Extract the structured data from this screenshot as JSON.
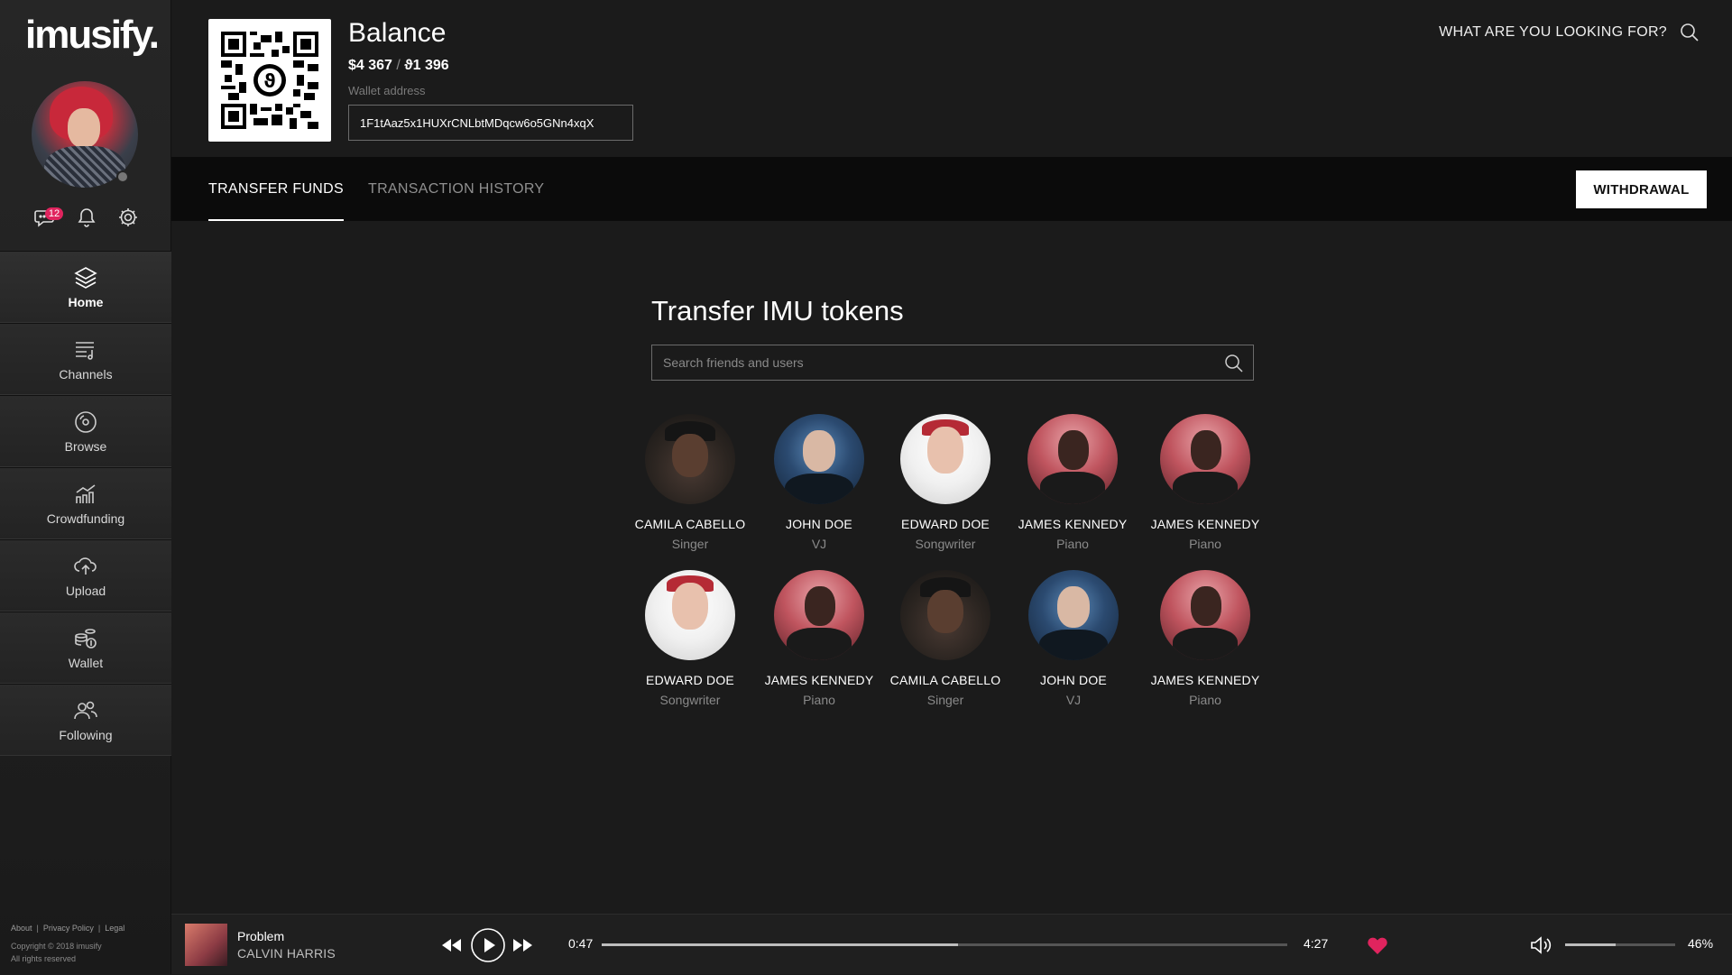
{
  "app": {
    "logo": "imusify."
  },
  "sidebar": {
    "messages_badge": "12",
    "nav": [
      {
        "label": "Home",
        "icon": "layers-icon",
        "active": true
      },
      {
        "label": "Channels",
        "icon": "playlist-icon"
      },
      {
        "label": "Browse",
        "icon": "disc-icon"
      },
      {
        "label": "Crowdfunding",
        "icon": "chart-icon"
      },
      {
        "label": "Upload",
        "icon": "cloud-upload-icon"
      },
      {
        "label": "Wallet",
        "icon": "coins-icon"
      },
      {
        "label": "Following",
        "icon": "users-icon"
      }
    ],
    "footer": {
      "links": [
        "About",
        "Privacy Policy",
        "Legal"
      ],
      "copyright": "Copyright © 2018 imusify",
      "rights": "All rights reserved"
    }
  },
  "header": {
    "balance_title": "Balance",
    "usd": "$4 367",
    "sep": "/",
    "tokens": "ϑ1 396",
    "wallet_label": "Wallet address",
    "wallet_address": "1F1tAaz5x1HUXrCNLbtMDqcw6o5GNn4xqX",
    "search_label": "WHAT ARE YOU LOOKING FOR?"
  },
  "tabs": [
    {
      "label": "TRANSFER FUNDS",
      "active": true
    },
    {
      "label": "TRANSACTION HISTORY",
      "active": false
    }
  ],
  "withdraw_label": "WITHDRAWAL",
  "main": {
    "title": "Transfer IMU tokens",
    "search_placeholder": "Search friends and users",
    "users": [
      {
        "name": "CAMILA CABELLO",
        "role": "Singer",
        "avatar": "p-cc"
      },
      {
        "name": "JOHN DOE",
        "role": "VJ",
        "avatar": "p-jd"
      },
      {
        "name": "EDWARD DOE",
        "role": "Songwriter",
        "avatar": "p-ed"
      },
      {
        "name": "JAMES KENNEDY",
        "role": "Piano",
        "avatar": "p-jk"
      },
      {
        "name": "JAMES KENNEDY",
        "role": "Piano",
        "avatar": "p-jk"
      },
      {
        "name": "EDWARD DOE",
        "role": "Songwriter",
        "avatar": "p-ed"
      },
      {
        "name": "JAMES KENNEDY",
        "role": "Piano",
        "avatar": "p-jk"
      },
      {
        "name": "CAMILA CABELLO",
        "role": "Singer",
        "avatar": "p-cc"
      },
      {
        "name": "JOHN DOE",
        "role": "VJ",
        "avatar": "p-jd"
      },
      {
        "name": "JAMES KENNEDY",
        "role": "Piano",
        "avatar": "p-jk"
      }
    ]
  },
  "player": {
    "song": "Problem",
    "artist": "CALVIN HARRIS",
    "elapsed": "0:47",
    "duration": "4:27",
    "progress": 0.52,
    "volume": "46%",
    "volume_level": 0.46,
    "liked": true,
    "like_color": "#e0245e"
  }
}
